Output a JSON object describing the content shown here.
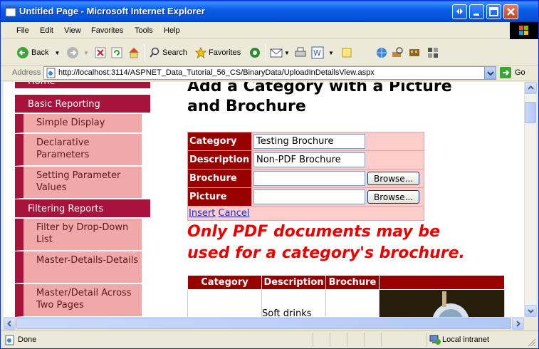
{
  "window": {
    "title": "Untitled Page - Microsoft Internet Explorer"
  },
  "menu": [
    "File",
    "Edit",
    "View",
    "Favorites",
    "Tools",
    "Help"
  ],
  "toolbar": {
    "back": "Back",
    "search": "Search",
    "favorites": "Favorites"
  },
  "address": {
    "label": "Address",
    "url": "http://localhost:3114/ASPNET_Data_Tutorial_56_CS/BinaryData/UploadInDetailsView.aspx",
    "go": "Go"
  },
  "nav": {
    "home": "Home",
    "basic_reporting": "Basic Reporting",
    "simple_display": "Simple Display",
    "declarative_parameters": "Declarative Parameters",
    "setting_parameter_values": "Setting Parameter Values",
    "filtering_reports": "Filtering Reports",
    "filter_dropdown": "Filter by Drop-Down List",
    "master_details": "Master-Details-Details",
    "master_detail_two_pages": "Master/Detail Across Two Pages"
  },
  "page": {
    "heading_line1": "Add a Category with a Picture",
    "heading_line2": "and Brochure",
    "form": {
      "category_label": "Category",
      "category_value": "Testing Brochure",
      "description_label": "Description",
      "description_value": "Non-PDF Brochure",
      "brochure_label": "Brochure",
      "picture_label": "Picture",
      "browse_label": "Browse...",
      "insert": "Insert",
      "cancel": "Cancel"
    },
    "error_line1": "Only PDF documents may be",
    "error_line2": "used for a category's brochure.",
    "grid": {
      "headers": [
        "Category",
        "Description",
        "Brochure",
        ""
      ],
      "row1_description": "Soft drinks"
    }
  },
  "status": {
    "text": "Done",
    "zone": "Local intranet"
  }
}
